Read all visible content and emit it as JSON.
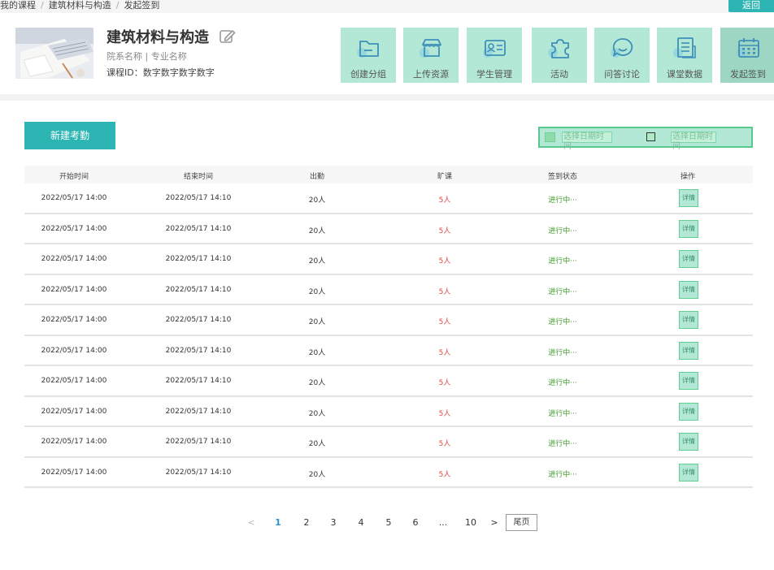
{
  "breadcrumb": {
    "items": [
      "我的课程",
      "建筑材料与构造",
      "发起签到"
    ],
    "sep": "/"
  },
  "back_label": "返回",
  "course": {
    "title": "建筑材料与构造",
    "dept_line": "院系名称 | 专业名称",
    "id_line": "课程ID：数字数字数字数字"
  },
  "tools": [
    {
      "label": "创建分组",
      "icon": "folder-icon"
    },
    {
      "label": "上传资源",
      "icon": "store-icon"
    },
    {
      "label": "学生管理",
      "icon": "id-card-icon"
    },
    {
      "label": "活动",
      "icon": "puzzle-icon"
    },
    {
      "label": "问答讨论",
      "icon": "chat-icon"
    },
    {
      "label": "课堂数据",
      "icon": "document-icon"
    },
    {
      "label": "发起签到",
      "icon": "calendar-icon"
    }
  ],
  "new_button": "新建考勤",
  "date_filter": {
    "start_placeholder": "选择日期时间",
    "end_placeholder": "选择日期时间"
  },
  "table": {
    "headers": [
      "开始时间",
      "结束时间",
      "出勤",
      "旷课",
      "签到状态",
      "操作"
    ],
    "rows": [
      {
        "start": "2022/05/17 14:00",
        "end": "2022/05/17 14:10",
        "attend": "20人",
        "absent": "5人",
        "status": "进行中···",
        "action": "详情"
      },
      {
        "start": "2022/05/17 14:00",
        "end": "2022/05/17 14:10",
        "attend": "20人",
        "absent": "5人",
        "status": "进行中···",
        "action": "详情"
      },
      {
        "start": "2022/05/17 14:00",
        "end": "2022/05/17 14:10",
        "attend": "20人",
        "absent": "5人",
        "status": "进行中···",
        "action": "详情"
      },
      {
        "start": "2022/05/17 14:00",
        "end": "2022/05/17 14:10",
        "attend": "20人",
        "absent": "5人",
        "status": "进行中···",
        "action": "详情"
      },
      {
        "start": "2022/05/17 14:00",
        "end": "2022/05/17 14:10",
        "attend": "20人",
        "absent": "5人",
        "status": "进行中···",
        "action": "详情"
      },
      {
        "start": "2022/05/17 14:00",
        "end": "2022/05/17 14:10",
        "attend": "20人",
        "absent": "5人",
        "status": "进行中···",
        "action": "详情"
      },
      {
        "start": "2022/05/17 14:00",
        "end": "2022/05/17 14:10",
        "attend": "20人",
        "absent": "5人",
        "status": "进行中···",
        "action": "详情"
      },
      {
        "start": "2022/05/17 14:00",
        "end": "2022/05/17 14:10",
        "attend": "20人",
        "absent": "5人",
        "status": "进行中···",
        "action": "详情"
      },
      {
        "start": "2022/05/17 14:00",
        "end": "2022/05/17 14:10",
        "attend": "20人",
        "absent": "5人",
        "status": "进行中···",
        "action": "详情"
      },
      {
        "start": "2022/05/17 14:00",
        "end": "2022/05/17 14:10",
        "attend": "20人",
        "absent": "5人",
        "status": "进行中···",
        "action": "详情"
      }
    ]
  },
  "pagination": {
    "prev": "<",
    "next": ">",
    "pages": [
      "1",
      "2",
      "3",
      "4",
      "5",
      "6",
      "...",
      "10"
    ],
    "current": "1",
    "last_label": "尾页"
  },
  "colors": {
    "accent": "#2cb5b3",
    "tile": "#b3e8d6",
    "absent": "#e04848",
    "status": "#3f9a2a",
    "page_current": "#2f8fd8"
  }
}
